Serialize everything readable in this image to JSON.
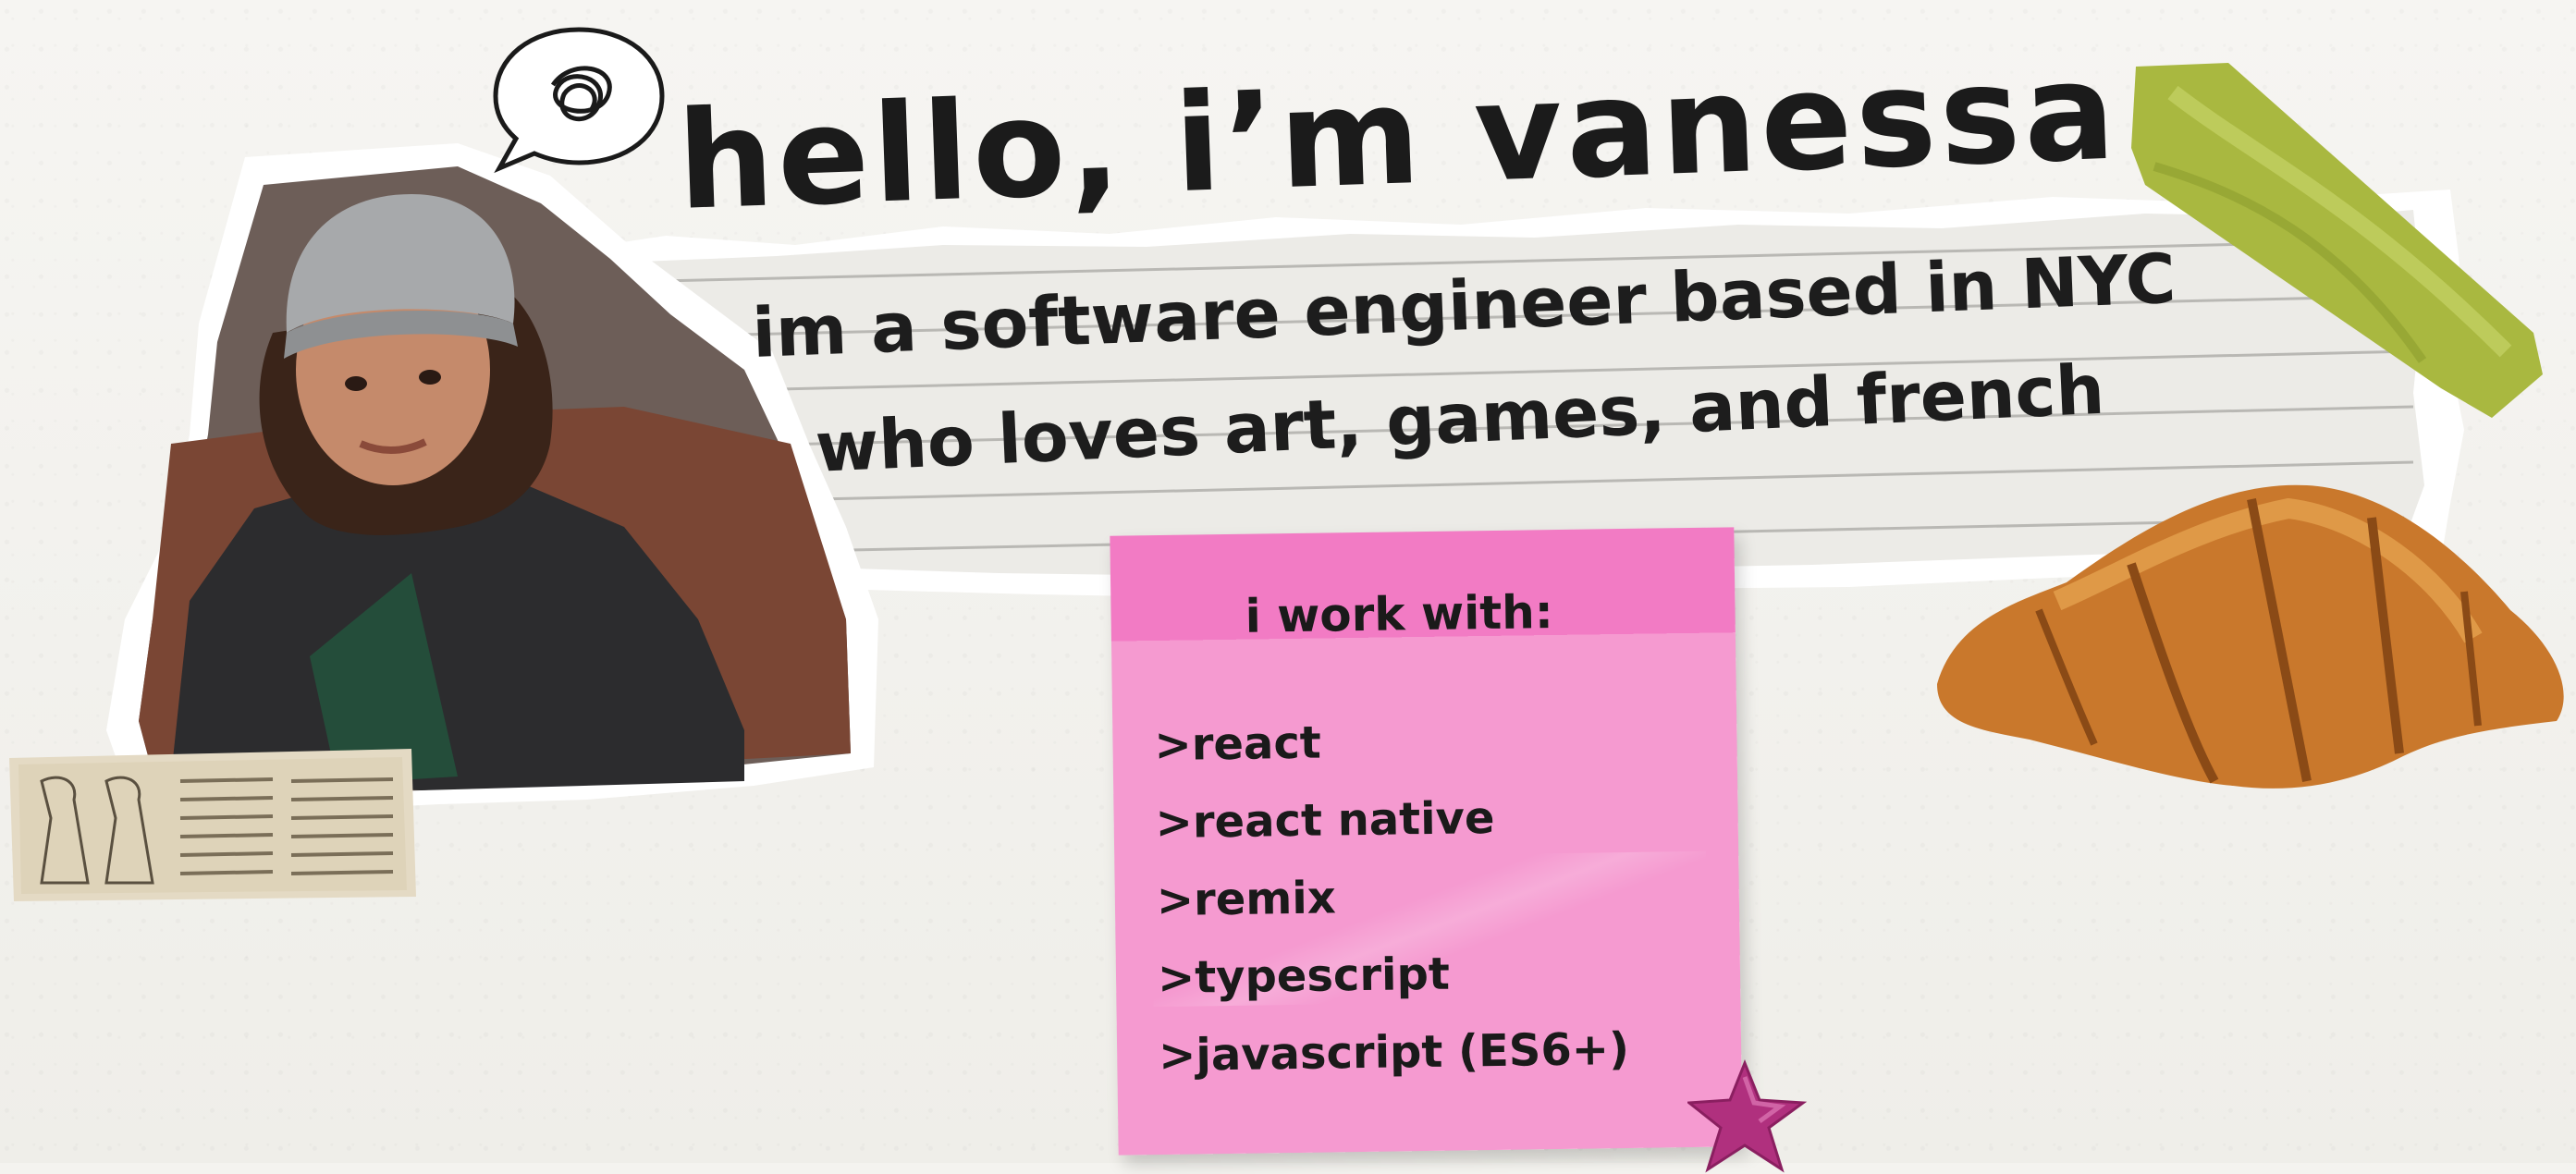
{
  "intro": {
    "greeting": "hello, i’m vanessa",
    "line1": "im a software engineer based in NYC",
    "line2": "who loves art, games, and french"
  },
  "sticky_note": {
    "title": "i work with:",
    "items": [
      ">react",
      ">react native",
      ">remix",
      ">typescript",
      ">javascript (ES6+)"
    ]
  },
  "decor": {
    "photo": "portrait-photo",
    "bubble": "speech-bubble-scribble-icon",
    "tape": "green-washi-tape",
    "croissant": "croissant-image",
    "clipping": "vintage-newspaper-clipping",
    "star": "pink-glitter-star-icon"
  },
  "colors": {
    "background": "#f4f3ef",
    "sticky_pink": "#f59ad0",
    "sticky_band": "#f27bc4",
    "tape_green": "#a9b840",
    "ink": "#1b1b1b",
    "star_pink": "#b0307e"
  }
}
